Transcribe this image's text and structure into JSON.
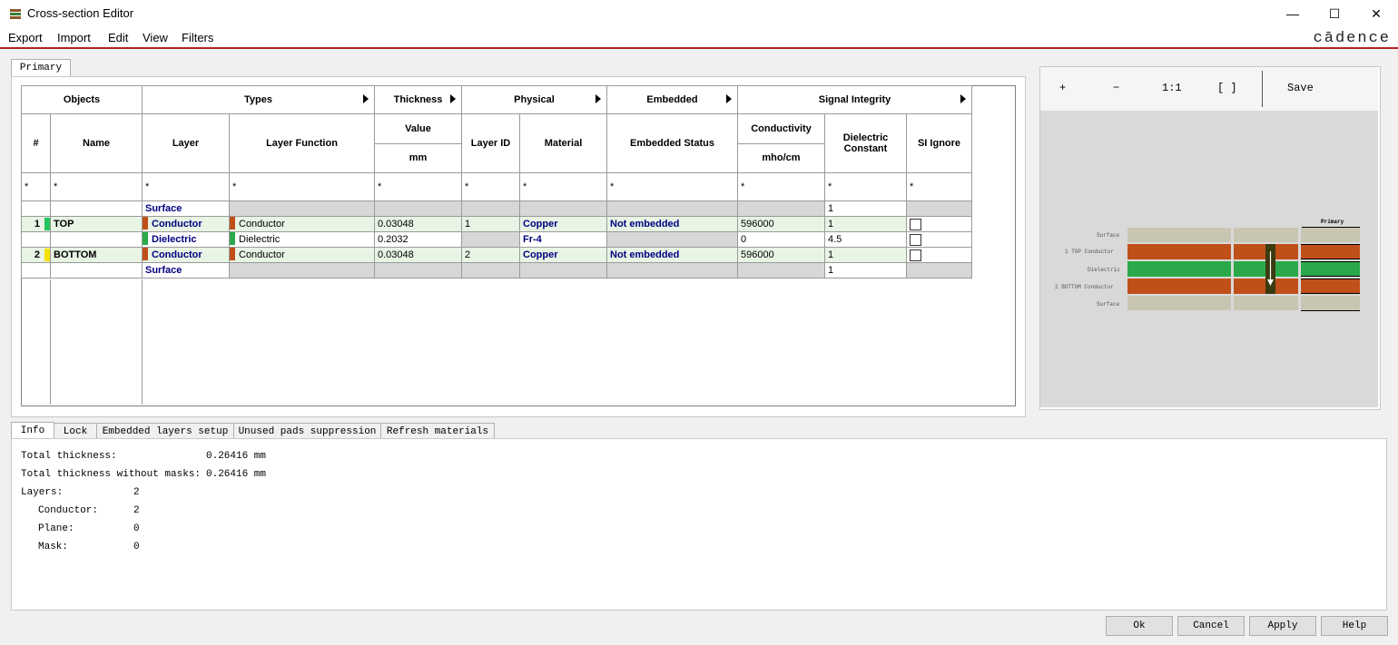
{
  "window": {
    "title": "Cross-section Editor",
    "minimize": "—",
    "maximize": "☐",
    "close": "✕"
  },
  "menu": [
    "Export",
    "Import",
    "Edit",
    "View",
    "Filters"
  ],
  "brand": "cādence",
  "top_tab": "Primary",
  "grid": {
    "groups": [
      "Objects",
      "Types",
      "Thickness",
      "Physical",
      "Embedded",
      "Signal Integrity"
    ],
    "columns": {
      "num": "#",
      "name": "Name",
      "layer": "Layer",
      "layer_function": "Layer Function",
      "value": "Value",
      "unit": "mm",
      "layer_id": "Layer ID",
      "material": "Material",
      "embedded_status": "Embedded Status",
      "conductivity": "Conductivity",
      "conductivity_unit": "mho/cm",
      "dielectric_constant": "Dielectric Constant",
      "si_ignore": "SI Ignore"
    },
    "filter": "*",
    "rows": [
      {
        "num": "",
        "name": "",
        "layer": "Surface",
        "function": "",
        "thickness": "",
        "layer_id": "",
        "material": "",
        "embedded": "",
        "conductivity": "",
        "dk": "1"
      },
      {
        "num": "1",
        "name": "TOP",
        "layer": "Conductor",
        "function": "Conductor",
        "thickness": "0.03048",
        "layer_id": "1",
        "material": "Copper",
        "embedded": "Not embedded",
        "conductivity": "596000",
        "dk": "1"
      },
      {
        "num": "",
        "name": "",
        "layer": "Dielectric",
        "function": "Dielectric",
        "thickness": "0.2032",
        "layer_id": "",
        "material": "Fr-4",
        "embedded": "",
        "conductivity": "0",
        "dk": "4.5"
      },
      {
        "num": "2",
        "name": "BOTTOM",
        "layer": "Conductor",
        "function": "Conductor",
        "thickness": "0.03048",
        "layer_id": "2",
        "material": "Copper",
        "embedded": "Not embedded",
        "conductivity": "596000",
        "dk": "1"
      },
      {
        "num": "",
        "name": "",
        "layer": "Surface",
        "function": "",
        "thickness": "",
        "layer_id": "",
        "material": "",
        "embedded": "",
        "conductivity": "",
        "dk": "1"
      }
    ]
  },
  "preview": {
    "zoom_in": "+",
    "zoom_out": "−",
    "actual": "1:1",
    "fit": "[ ]",
    "save": "Save",
    "column_header": "Primary",
    "labels": [
      "Surface",
      "1   TOP Conductor",
      "Dielectric",
      "2   BOTTOM Conductor",
      "Surface"
    ]
  },
  "bottom_tabs": [
    "Info",
    "Lock",
    "Embedded layers setup",
    "Unused pads suppression",
    "Refresh materials"
  ],
  "info": {
    "total_thickness_label": "Total thickness:",
    "total_thickness": "0.26416 mm",
    "total_without_masks_label": "Total thickness without masks:",
    "total_without_masks": "0.26416 mm",
    "layers_label": "Layers:",
    "layers": "2",
    "conductor_label": "Conductor:",
    "conductor": "2",
    "plane_label": "Plane:",
    "plane": "0",
    "mask_label": "Mask:",
    "mask": "0"
  },
  "buttons": {
    "ok": "Ok",
    "cancel": "Cancel",
    "apply": "Apply",
    "help": "Help"
  },
  "colors": {
    "conductor": "#c0501a",
    "dielectric": "#2aa84a",
    "surface": "#c9c5b3",
    "top_marker": "#22c55e",
    "bottom_marker": "#f5e200",
    "accent": "#b22222"
  }
}
